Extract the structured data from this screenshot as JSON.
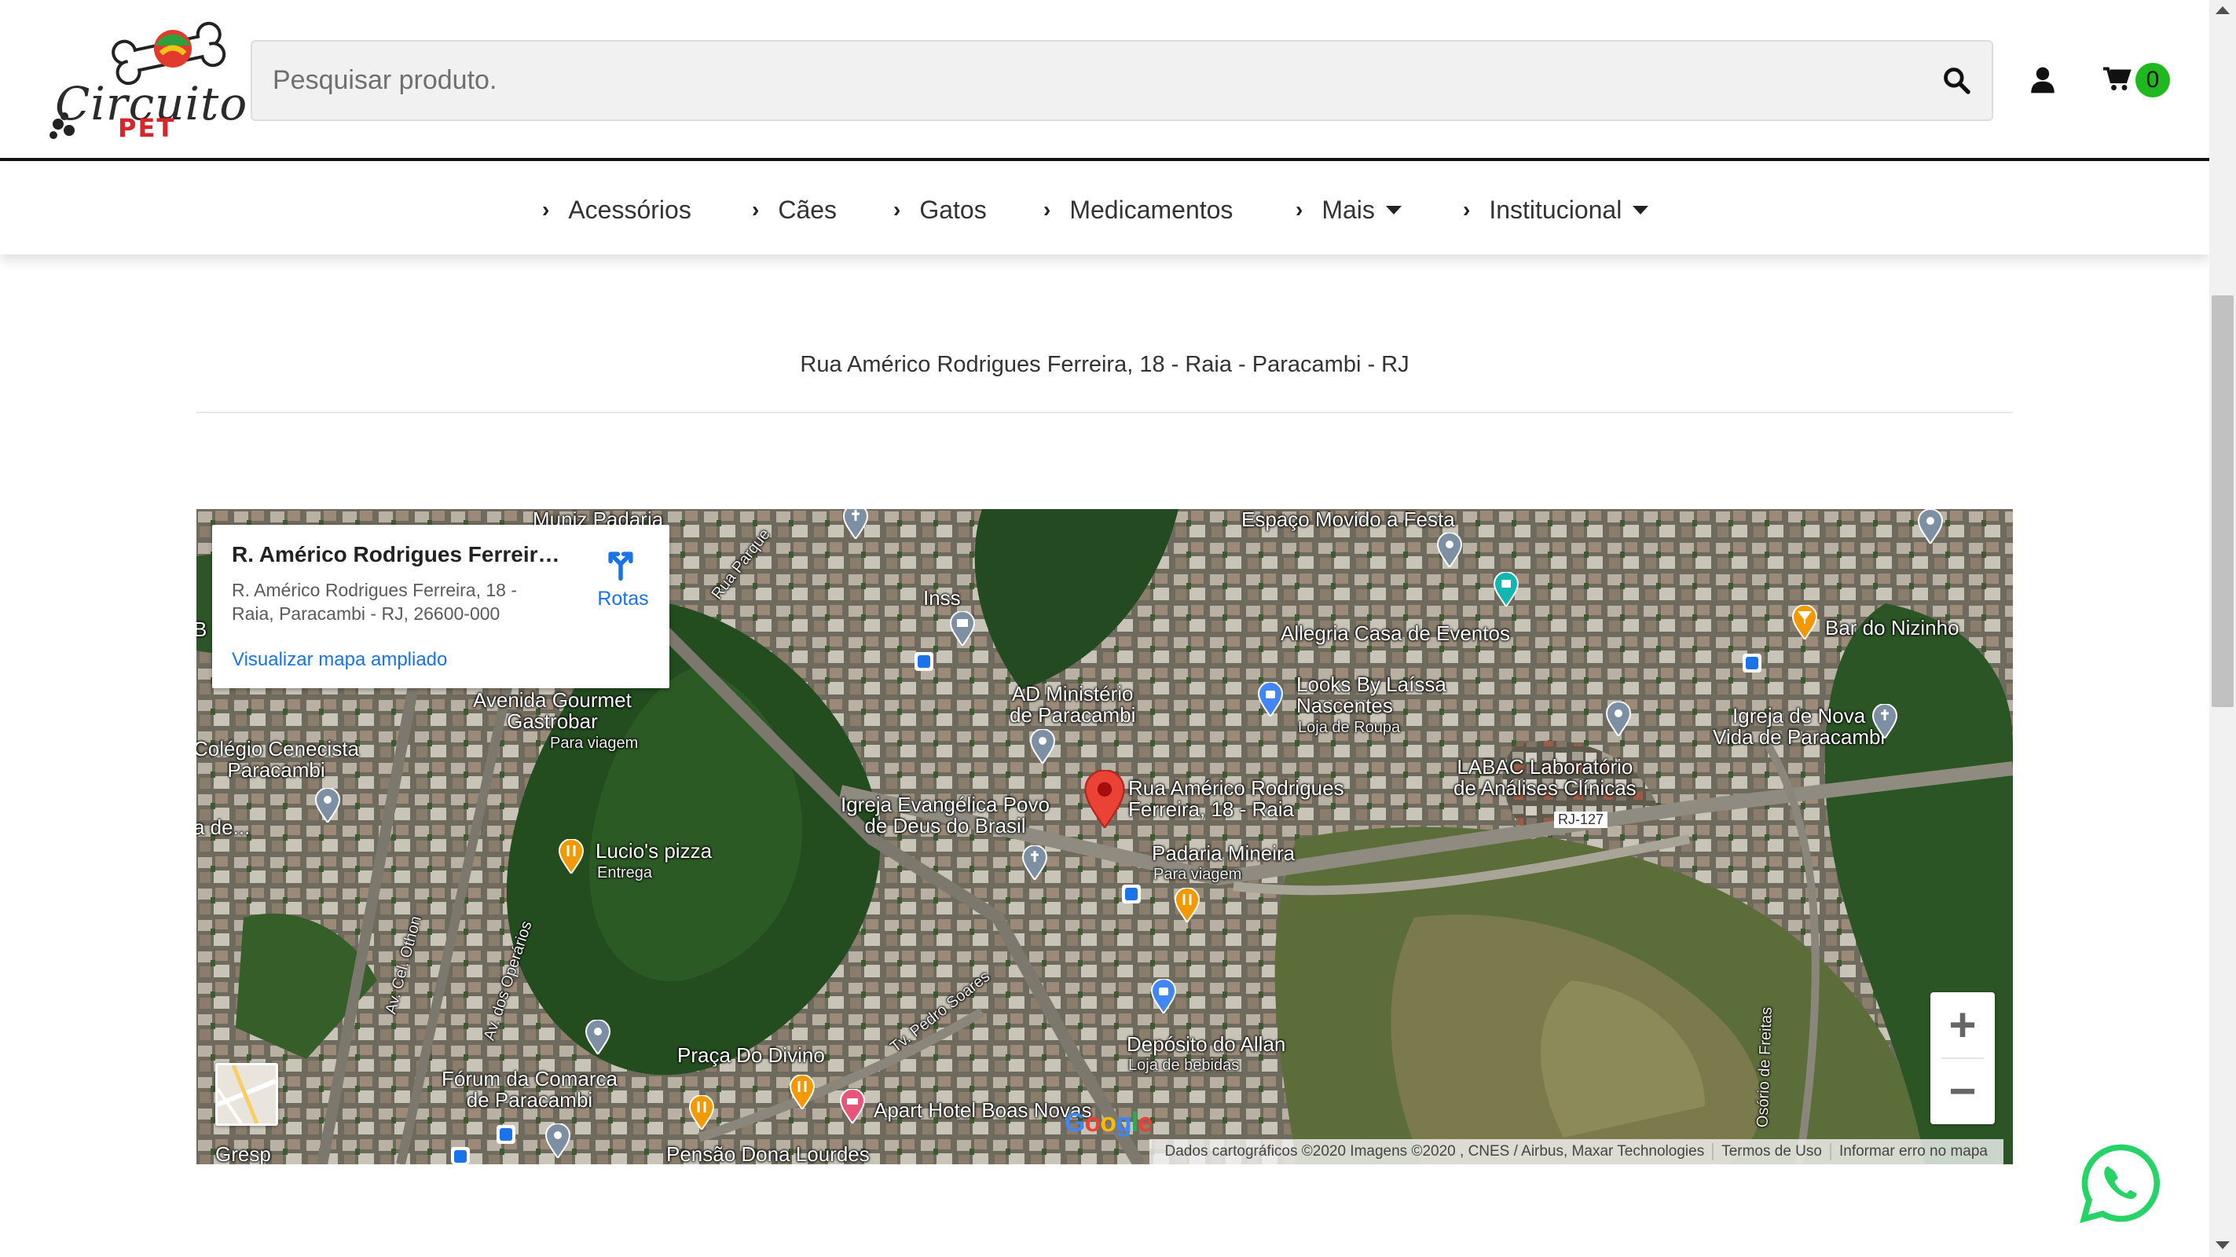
{
  "header": {
    "logo": {
      "title": "Circuito",
      "subtitle": "PET"
    },
    "search": {
      "placeholder": "Pesquisar produto.",
      "value": ""
    },
    "cart": {
      "count": "0"
    }
  },
  "nav": {
    "items": [
      {
        "label": "Acessórios",
        "dropdown": false
      },
      {
        "label": "Cães",
        "dropdown": false
      },
      {
        "label": "Gatos",
        "dropdown": false
      },
      {
        "label": "Medicamentos",
        "dropdown": false
      },
      {
        "label": "Mais",
        "dropdown": true
      },
      {
        "label": "Institucional",
        "dropdown": true
      }
    ]
  },
  "address": "Rua Américo Rodrigues Ferreira, 18 - Raia -  Paracambi - RJ",
  "map": {
    "info_card": {
      "title": "R. Américo Rodrigues Ferreira...",
      "address": "R. Américo Rodrigues Ferreira, 18 - Raia, Paracambi - RJ, 26600-000",
      "view_larger": "Visualizar mapa ampliado",
      "directions": "Rotas"
    },
    "labels": {
      "muniz": "Muniz Padaria",
      "rua_parque": "Rua Parque",
      "espaco": "Espaço Movido a Festa",
      "inss": "Inss",
      "allegria": "Allegria Casa de Eventos",
      "bar_nizinho": "Bar do Nizinho",
      "avenida_gourmet": "Avenida Gourmet\nGastrobar",
      "avenida_gourmet_sub": "Para viagem",
      "ad_ministerio": "AD Ministério\nde Paracambi",
      "looks": "Looks By Laíssa\nNascentes",
      "looks_sub": "Loja de Roupa",
      "igreja_nova": "Igreja de Nova\nVida de Paracambi",
      "colegio": "Colégio Cenecista\nParacambi",
      "labac": "LABAC Laboratório\nde Análises Clínicas",
      "rj127": "RJ-127",
      "destination": "Rua Américo Rodrigues\nFerreira, 18 - Raia",
      "igreja_evangelica": "Igreja Evangélica Povo\nde Deus do Brasil",
      "de": "a de...",
      "b_left": "B",
      "lucios": "Lucio's pizza",
      "lucios_sub": "Entrega",
      "padaria_mineira": "Padaria Mineira",
      "padaria_sub": "Para viagem",
      "av_othon": "Av. Cel. Othon",
      "av_operarios": "Av. dos Operários",
      "tv_pedro": "Tv. Pedro Soares",
      "osorio": "Osório de Freitas",
      "praca": "Praça Do Divino",
      "deposito": "Depósito do Allan",
      "deposito_sub": "Loja de bebidas",
      "forum": "Fórum da Comarca\nde Paracambi",
      "apart": "Apart Hotel Boas Novas",
      "pensao": "Pensão Dona Lourdes",
      "gresp": "Gresp"
    },
    "attribution": {
      "data": "Dados cartográficos ©2020 Imagens ©2020 , CNES / Airbus, Maxar Technologies",
      "terms": "Termos de Uso",
      "report": "Informar erro no mapa"
    },
    "google": "Google"
  },
  "colors": {
    "cart_badge": "#1fb81f",
    "link": "#1a73e8",
    "logo_pet": "#d7262b",
    "whatsapp": "#25d366",
    "marker_red": "#ea4335"
  }
}
